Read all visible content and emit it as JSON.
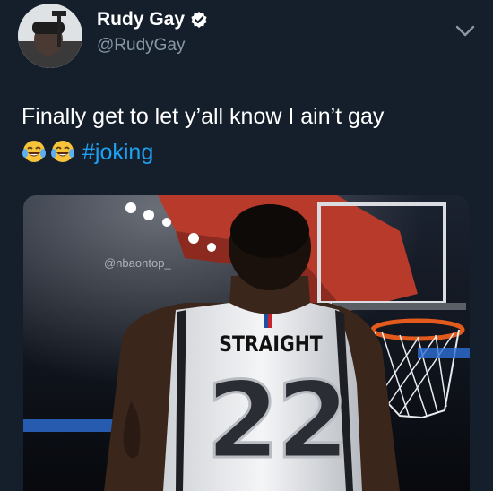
{
  "tweet": {
    "display_name": "Rudy Gay",
    "handle": "@RudyGay",
    "text": "Finally get to let y’all know I ain’t gay",
    "emojis": [
      "face-with-tears-of-joy",
      "face-with-tears-of-joy"
    ],
    "hashtag": "#joking"
  },
  "media": {
    "watermark": "@nbaontop_",
    "jersey_name": "STRAIGHT",
    "jersey_number": "22"
  },
  "colors": {
    "background": "#151f2c",
    "hashtag": "#1da1f2",
    "handle": "#8899a6",
    "verified_badge": "#ffffff"
  }
}
